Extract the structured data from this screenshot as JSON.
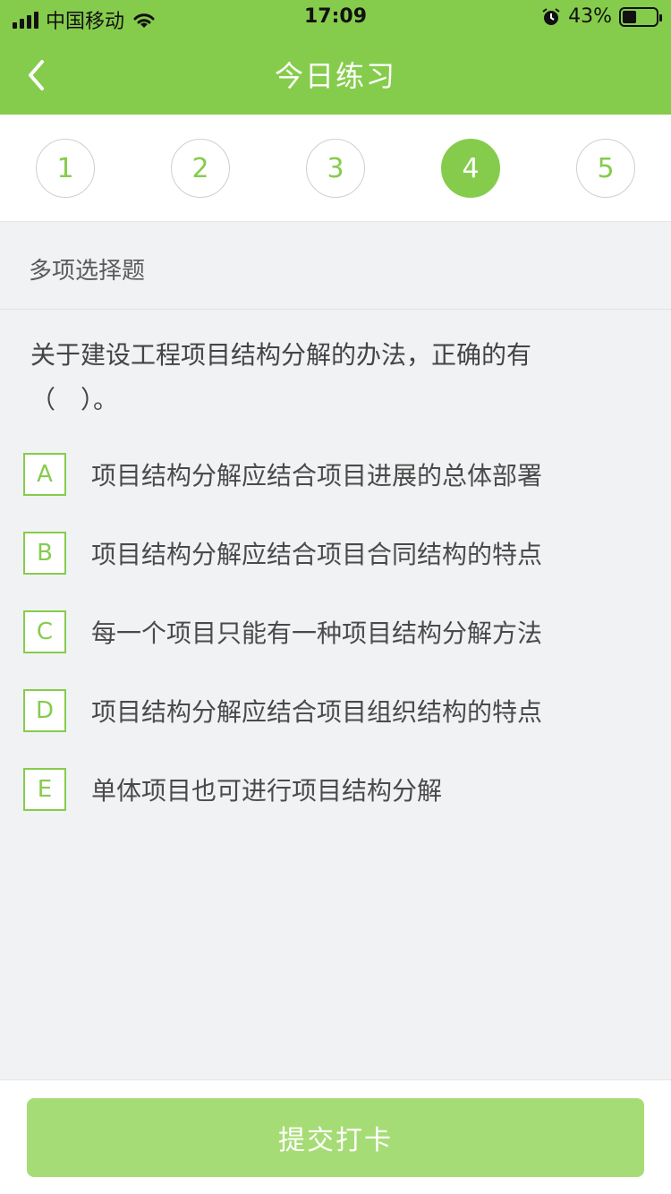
{
  "status_bar": {
    "carrier": "中国移动",
    "time": "17:09",
    "battery_percent_text": "43%",
    "battery_level": 0.43,
    "icons": [
      "signal-icon",
      "wifi-icon",
      "alarm-icon",
      "battery-icon"
    ]
  },
  "nav": {
    "title": "今日练习",
    "back_icon": "chevron-left-icon"
  },
  "steps": {
    "items": [
      "1",
      "2",
      "3",
      "4",
      "5"
    ],
    "active": "4"
  },
  "question": {
    "type": "多项选择题",
    "text": "关于建设工程项目结构分解的办法，正确的有（　）。",
    "options": [
      {
        "letter": "A",
        "text": "项目结构分解应结合项目进展的总体部署"
      },
      {
        "letter": "B",
        "text": "项目结构分解应结合项目合同结构的特点"
      },
      {
        "letter": "C",
        "text": "每一个项目只能有一种项目结构分解方法"
      },
      {
        "letter": "D",
        "text": "项目结构分解应结合项目组织结构的特点"
      },
      {
        "letter": "E",
        "text": "单体项目也可进行项目结构分解"
      }
    ]
  },
  "footer": {
    "submit_label": "提交打卡"
  },
  "colors": {
    "primary": "#86cc4c",
    "submit_disabled": "#a6dc75",
    "background": "#f1f2f4"
  }
}
